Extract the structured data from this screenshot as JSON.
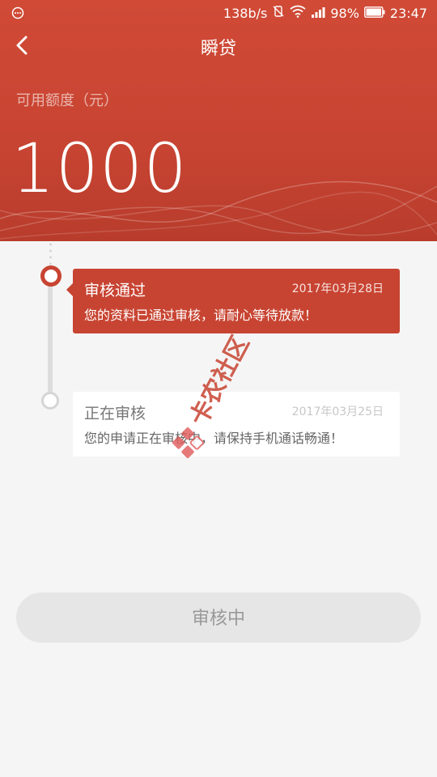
{
  "status_bar": {
    "network_speed": "138b/s",
    "battery": "98%",
    "time": "23:47"
  },
  "header": {
    "title": "瞬贷",
    "quota_label": "可用额度（元）",
    "quota_value": "1000"
  },
  "timeline": [
    {
      "title": "审核通过",
      "date": "2017年03月28日",
      "description": "您的资料已通过审核，请耐心等待放款！",
      "state": "active"
    },
    {
      "title": "正在审核",
      "date": "2017年03月25日",
      "description": "您的申请正在审核中，请保持手机通话畅通！",
      "state": "pending"
    }
  ],
  "footer": {
    "status_button_label": "审核中"
  },
  "watermark": {
    "text": "卡农社区"
  },
  "colors": {
    "primary": "#c84432",
    "disabled_button": "#e6e6e6",
    "background": "#f5f5f5"
  }
}
